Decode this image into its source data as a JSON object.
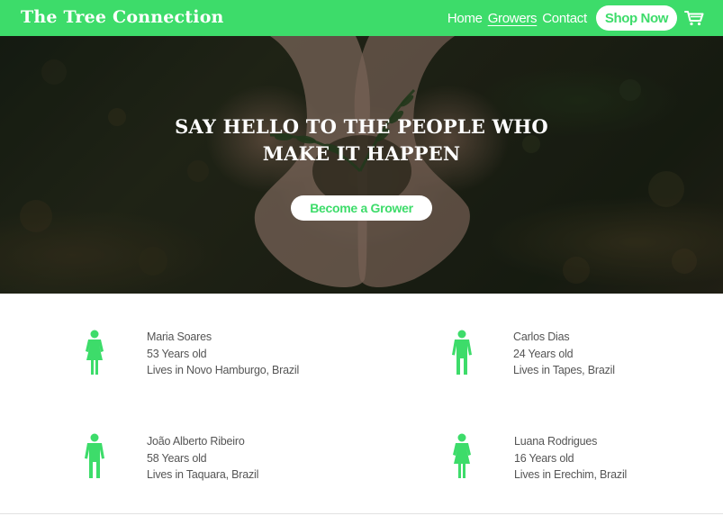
{
  "nav": {
    "brand": "The Tree Connection",
    "links": [
      {
        "label": "Home",
        "active": false
      },
      {
        "label": "Growers",
        "active": true
      },
      {
        "label": "Contact",
        "active": false
      }
    ],
    "shop_button": "Shop Now",
    "cart_icon": "shopping-cart-icon"
  },
  "hero": {
    "title_line1": "SAY HELLO TO THE PEOPLE WHO",
    "title_line2": "MAKE IT HAPPEN",
    "button": "Become a Grower"
  },
  "growers": [
    {
      "icon": "female-person-icon",
      "name": "Maria Soares",
      "age": "53 Years old",
      "location": "Lives in Novo Hamburgo, Brazil"
    },
    {
      "icon": "male-person-icon",
      "name": "Carlos Dias",
      "age": "24 Years old",
      "location": "Lives in Tapes, Brazil"
    },
    {
      "icon": "male-person-icon",
      "name": "João Alberto Ribeiro",
      "age": "58 Years old",
      "location": "Lives in Taquara, Brazil"
    },
    {
      "icon": "female-person-icon",
      "name": "Luana Rodrigues",
      "age": "16 Years old",
      "location": "Lives in Erechim, Brazil"
    }
  ],
  "colors": {
    "accent": "#3ddc6a",
    "text": "#555555"
  }
}
